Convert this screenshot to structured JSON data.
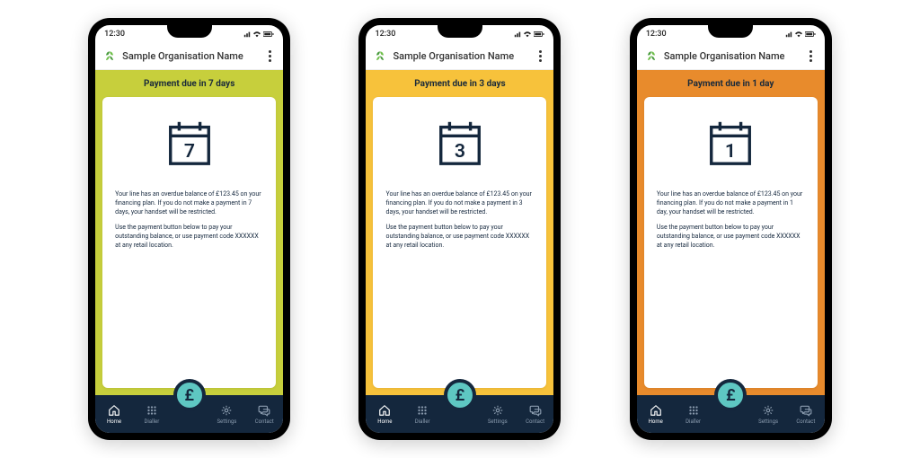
{
  "status": {
    "time": "12:30"
  },
  "app": {
    "title": "Sample Organisation Name"
  },
  "nav": {
    "home": "Home",
    "dialler": "Dialler",
    "settings": "Settings",
    "contact": "Contact",
    "fab_glyph": "£"
  },
  "message_p2": "Use the payment button below to pay your outstanding balance, or use payment code XXXXXX at any retail location.",
  "screens": [
    {
      "accent": "#c7cf3c",
      "banner": "Payment due in 7 days",
      "days": "7",
      "p1": "Your line has an overdue balance of £123.45 on your  financing plan.   If you do not make a payment in 7 days, your handset will be restricted."
    },
    {
      "accent": "#f7c23b",
      "banner": "Payment due in 3 days",
      "days": "3",
      "p1": "Your line has an overdue balance of £123.45 on your  financing plan.   If you do not make a payment in 3 days, your handset will be restricted."
    },
    {
      "accent": "#e88b2c",
      "banner": "Payment due in 1 day",
      "days": "1",
      "p1": "Your line has an overdue balance of £123.45 on your  financing plan.   If you do not make a payment in 1 day, your handset will be restricted."
    }
  ]
}
